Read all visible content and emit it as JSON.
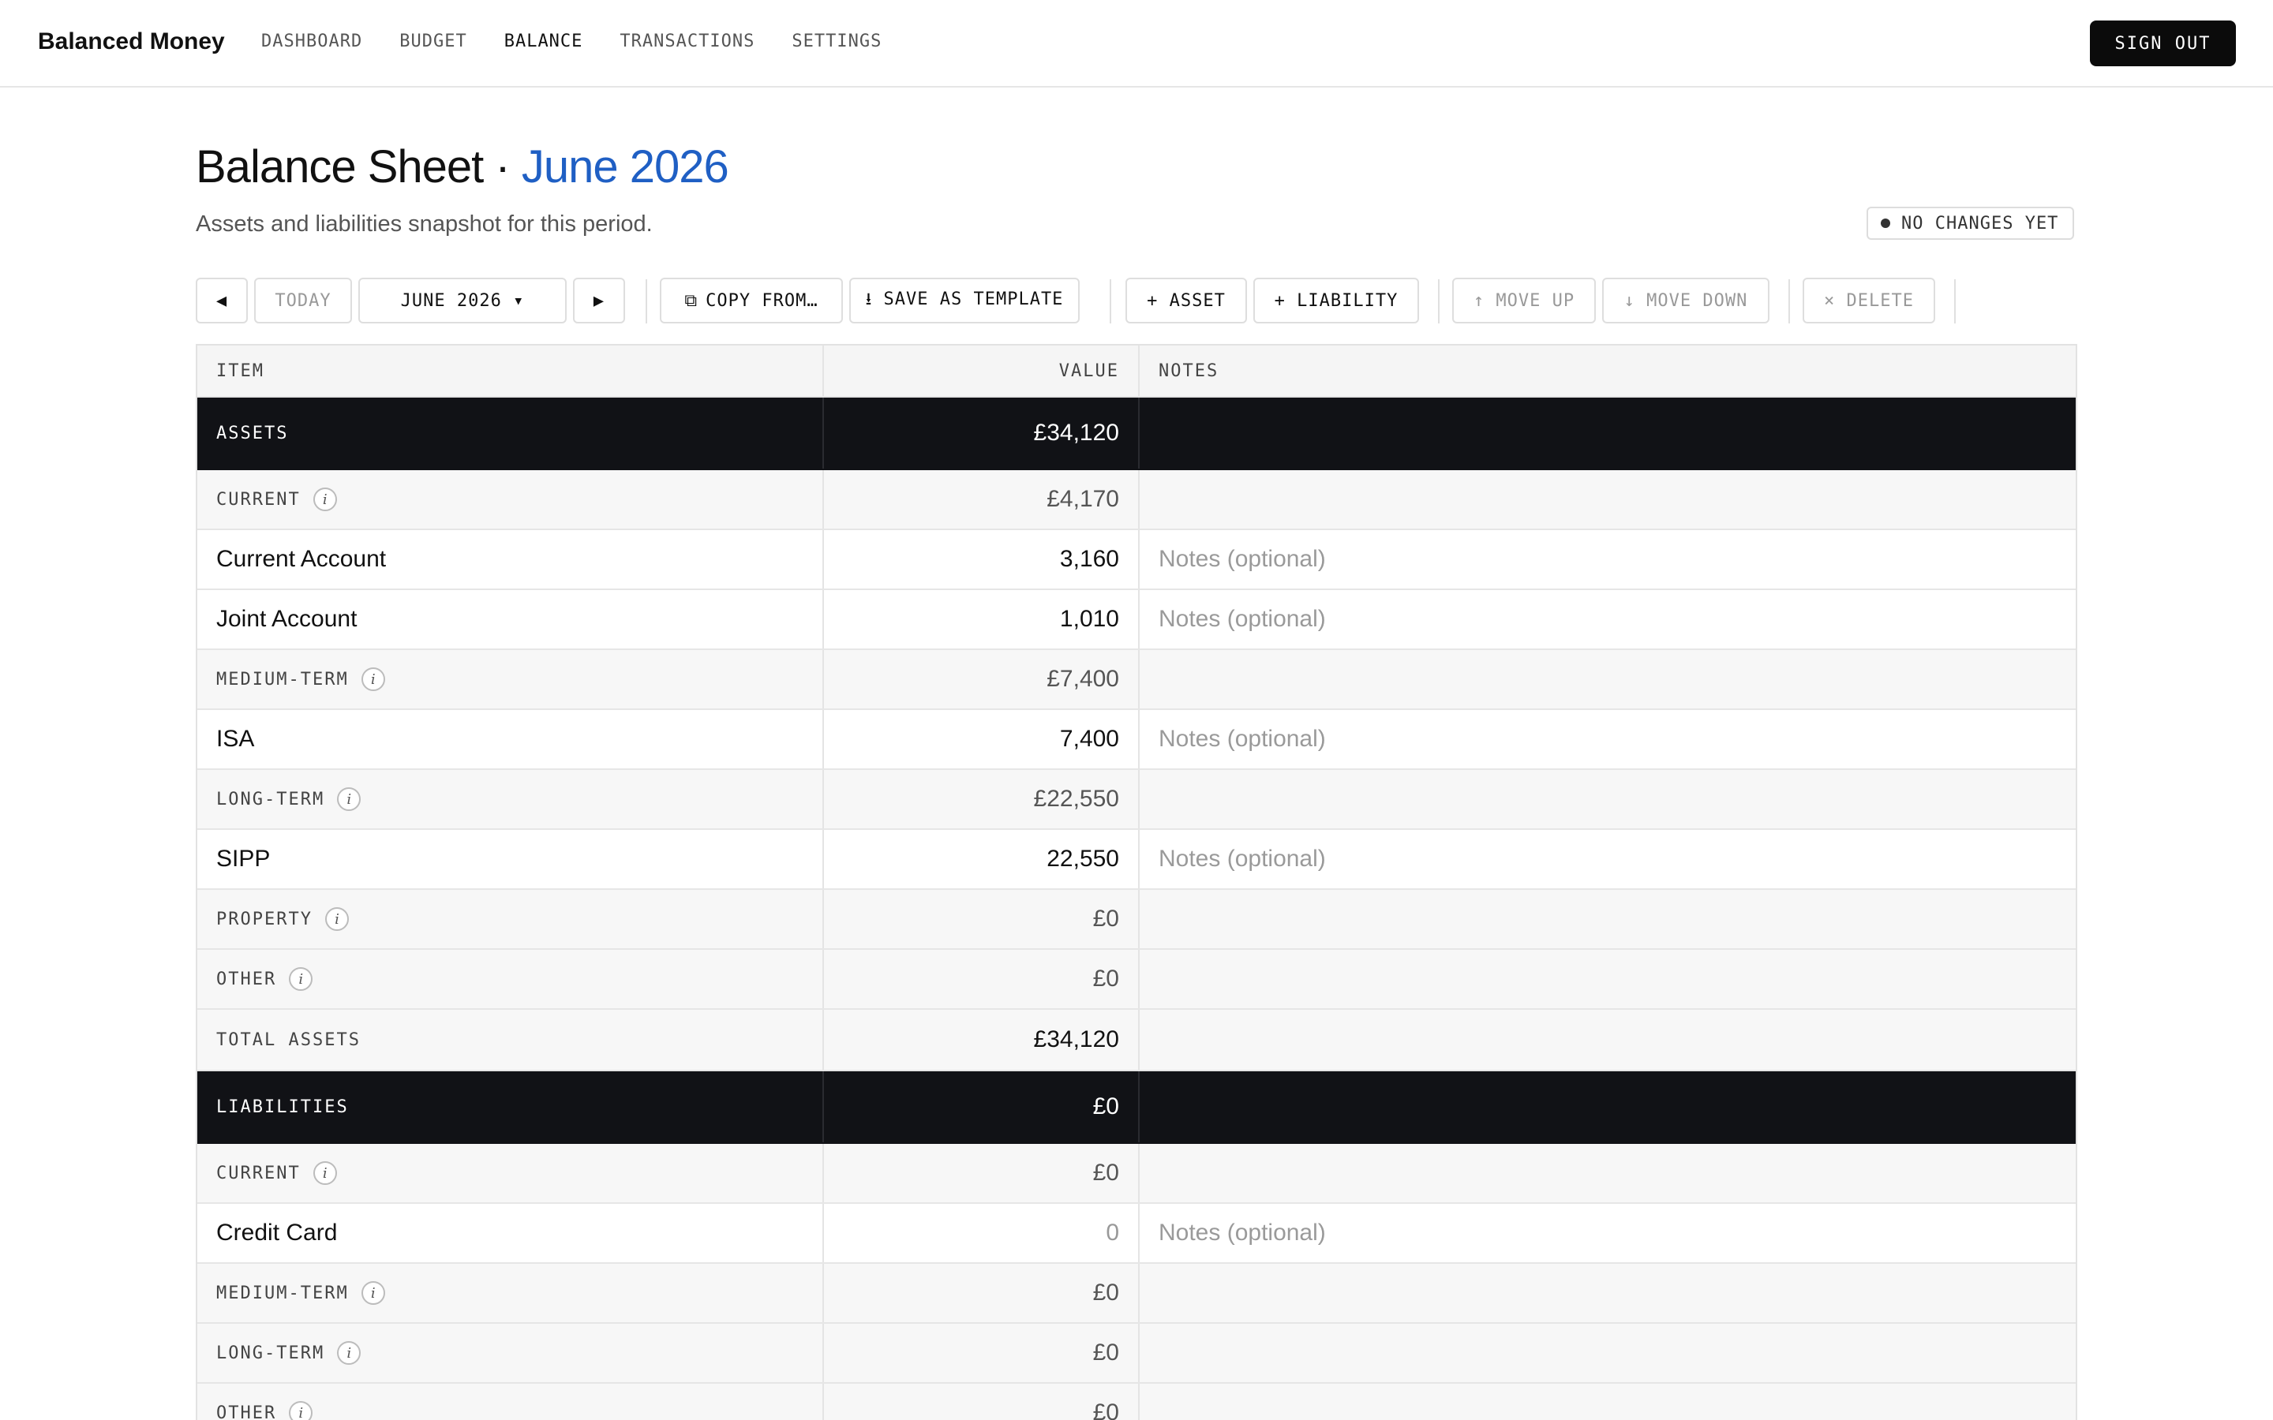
{
  "brand": "Balanced Money",
  "nav": [
    {
      "label": "DASHBOARD",
      "active": false
    },
    {
      "label": "BUDGET",
      "active": false
    },
    {
      "label": "BALANCE",
      "active": true
    },
    {
      "label": "TRANSACTIONS",
      "active": false
    },
    {
      "label": "SETTINGS",
      "active": false
    }
  ],
  "sign_out": "SIGN OUT",
  "page": {
    "title": "Balance Sheet",
    "separator": " · ",
    "period": "June 2026",
    "subtitle": "Assets and liabilities snapshot for this period.",
    "status": "NO CHANGES YET"
  },
  "toolbar": {
    "prev": "◀",
    "today": "TODAY",
    "month": "JUNE 2026 ▾",
    "next": "▶",
    "copy_icon": "⧉",
    "copy": "COPY FROM…",
    "save_template": "⭳ SAVE AS TEMPLATE",
    "add_asset": "+ ASSET",
    "add_liability": "+ LIABILITY",
    "move_up": "↑ MOVE UP",
    "move_down": "↓ MOVE DOWN",
    "delete": "× DELETE"
  },
  "table": {
    "headers": {
      "item": "ITEM",
      "value": "VALUE",
      "notes": "NOTES"
    },
    "rows": [
      {
        "kind": "section",
        "label": "ASSETS",
        "value": "£34,120"
      },
      {
        "kind": "group",
        "label": "CURRENT",
        "value": "£4,170",
        "info": "i"
      },
      {
        "kind": "item",
        "label": "Current Account",
        "value": "3,160",
        "note": "Notes (optional)"
      },
      {
        "kind": "item",
        "label": "Joint Account",
        "value": "1,010",
        "note": "Notes (optional)"
      },
      {
        "kind": "group",
        "label": "MEDIUM-TERM",
        "value": "£7,400",
        "info": "i"
      },
      {
        "kind": "item",
        "label": "ISA",
        "value": "7,400",
        "note": "Notes (optional)"
      },
      {
        "kind": "group",
        "label": "LONG-TERM",
        "value": "£22,550",
        "info": "i"
      },
      {
        "kind": "item",
        "label": "SIPP",
        "value": "22,550",
        "note": "Notes (optional)"
      },
      {
        "kind": "group",
        "label": "PROPERTY",
        "value": "£0",
        "info": "i"
      },
      {
        "kind": "group",
        "label": "OTHER",
        "value": "£0",
        "info": "i"
      },
      {
        "kind": "total",
        "label": "TOTAL ASSETS",
        "value": "£34,120"
      },
      {
        "kind": "section",
        "label": "LIABILITIES",
        "value": "£0"
      },
      {
        "kind": "group",
        "label": "CURRENT",
        "value": "£0",
        "info": "i"
      },
      {
        "kind": "item",
        "label": "Credit Card",
        "value": "0",
        "note": "Notes (optional)",
        "zero": true
      },
      {
        "kind": "group",
        "label": "MEDIUM-TERM",
        "value": "£0",
        "info": "i"
      },
      {
        "kind": "group",
        "label": "LONG-TERM",
        "value": "£0",
        "info": "i"
      },
      {
        "kind": "group",
        "label": "OTHER",
        "value": "£0",
        "info": "i"
      }
    ]
  },
  "colors": {
    "accent": "#1f5fc4",
    "section_bg": "#111216"
  }
}
